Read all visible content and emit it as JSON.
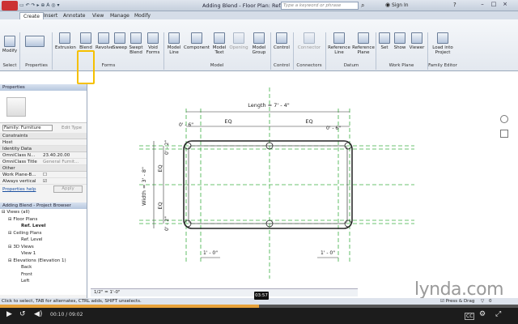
{
  "titlebar": {
    "title": "Adding Blend - Floor Plan: Ref...",
    "search_placeholder": "Type a keyword or phrase",
    "sign_in": "Sign In"
  },
  "tabs": [
    "Create",
    "Insert",
    "Annotate",
    "View",
    "Manage",
    "Modify"
  ],
  "ribbon": {
    "select_panel": {
      "tools": [
        "Modify"
      ],
      "label": "Select"
    },
    "properties_panel": {
      "label": "Properties"
    },
    "forms_panel": {
      "tools": [
        "Extrusion",
        "Blend",
        "Revolve",
        "Sweep",
        "Swept Blend",
        "Void Forms"
      ],
      "label": "Forms"
    },
    "model_panel": {
      "tools": [
        "Model Line",
        "Component",
        "Model Text",
        "Opening",
        "Model Group"
      ],
      "label": "Model"
    },
    "control_panel": {
      "tools": [
        "Control"
      ],
      "label": "Control"
    },
    "connectors_panel": {
      "tools": [
        "Connector"
      ],
      "label": "Connectors"
    },
    "datum_panel": {
      "tools": [
        "Reference Line",
        "Reference Plane"
      ],
      "label": "Datum"
    },
    "workplane_panel": {
      "tools": [
        "Set",
        "Show",
        "Viewer"
      ],
      "label": "Work Plane"
    },
    "family_editor_panel": {
      "tools": [
        "Load into Project"
      ],
      "label": "Family Editor"
    }
  },
  "properties": {
    "header": "Properties",
    "family_select": "Family: Furniture",
    "edit_type": "Edit Type",
    "sections": [
      {
        "title": "Constraints",
        "rows": [
          [
            "Host",
            ""
          ]
        ]
      },
      {
        "title": "Identity Data",
        "rows": [
          [
            "OmniClass N...",
            "23.40.20.00"
          ],
          [
            "OmniClass Title",
            "General Furnit..."
          ]
        ]
      },
      {
        "title": "Other",
        "rows": [
          [
            "Work Plane-B...",
            ""
          ],
          [
            "Always vertical",
            ""
          ]
        ]
      }
    ],
    "help": "Properties help",
    "apply": "Apply"
  },
  "browser": {
    "header": "Adding Blend - Project Browser",
    "items": [
      "Views (all)",
      "Floor Plans",
      "Ref. Level",
      "Ceiling Plans",
      "Ref. Level",
      "3D Views",
      "View 1",
      "Elevations (Elevation 1)",
      "Back",
      "Front",
      "Left"
    ]
  },
  "drawing": {
    "length_label": "Length = 7' - 4\"",
    "eq_label": "EQ",
    "width_label": "Width = 3' - 8\"",
    "dim_0_6": "0' - 6\"",
    "dim_0_2": "0' - 2\"",
    "dim_1_0": "1' - 0\"",
    "scale": "1/2\" = 1'-0\""
  },
  "status": {
    "text": "Click to select, TAB for alternates, CTRL adds, SHIFT unselects.",
    "press_drag": "Press & Drag",
    "filter_count": "0"
  },
  "player": {
    "current": "00:10",
    "total": "09:02",
    "tooltip": "03:57",
    "progress": 0.5,
    "watermark": "lynda.com",
    "cc": "CC"
  }
}
